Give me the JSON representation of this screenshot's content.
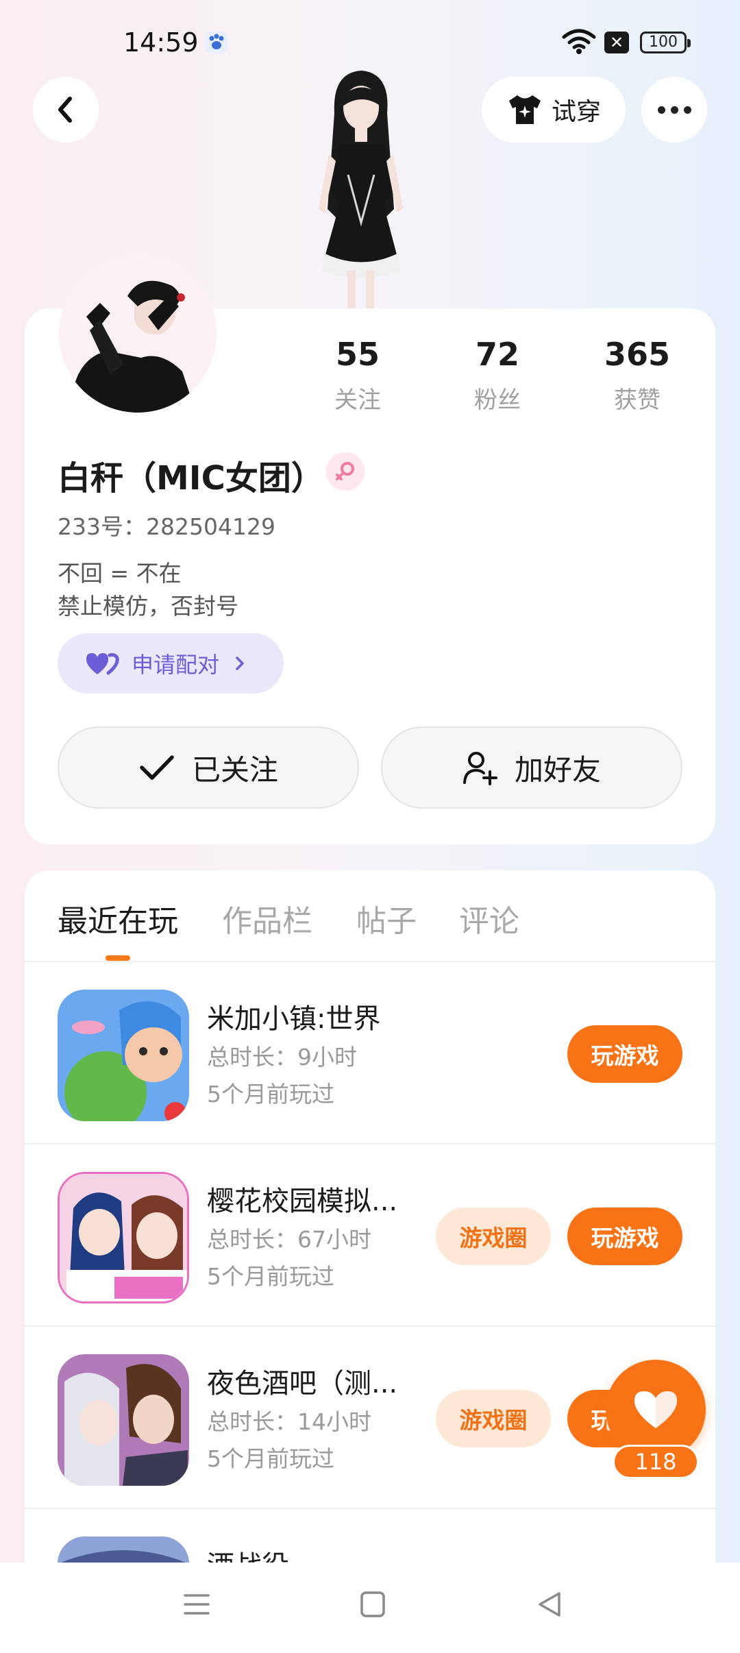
{
  "status_bar": {
    "time": "14:59",
    "battery": "100"
  },
  "header": {
    "try_on_label": "试穿"
  },
  "profile": {
    "stats": [
      {
        "value": "55",
        "label": "关注"
      },
      {
        "value": "72",
        "label": "粉丝"
      },
      {
        "value": "365",
        "label": "获赞"
      }
    ],
    "name": "白秆（MIC女团）",
    "id_line": "233号：282504129",
    "bio_lines": [
      "不回 = 不在",
      "禁止模仿，否封号"
    ],
    "pair_label": "申请配对",
    "followed_label": "已关注",
    "add_friend_label": "加好友"
  },
  "tabs": [
    {
      "label": "最近在玩",
      "active": true
    },
    {
      "label": "作品栏",
      "active": false
    },
    {
      "label": "帖子",
      "active": false
    },
    {
      "label": "评论",
      "active": false
    }
  ],
  "games": [
    {
      "name": "米加小镇:世界",
      "duration": "总时长：9小时",
      "last_played": "5个月前玩过",
      "play_label": "玩游戏",
      "circle_label": ""
    },
    {
      "name": "樱花校园模拟...",
      "duration": "总时长：67小时",
      "last_played": "5个月前玩过",
      "play_label": "玩游戏",
      "circle_label": "游戏圈"
    },
    {
      "name": "夜色酒吧（测...",
      "duration": "总时长：14小时",
      "last_played": "5个月前玩过",
      "play_label": "玩游戏",
      "circle_label": "游戏圈"
    },
    {
      "name": "酒战役",
      "duration": "",
      "last_played": "",
      "play_label": "",
      "circle_label": ""
    }
  ],
  "like": {
    "count": "118"
  },
  "colors": {
    "accent": "#f77315",
    "pair": "#6b5ed6",
    "muted": "#a0a0a0"
  }
}
